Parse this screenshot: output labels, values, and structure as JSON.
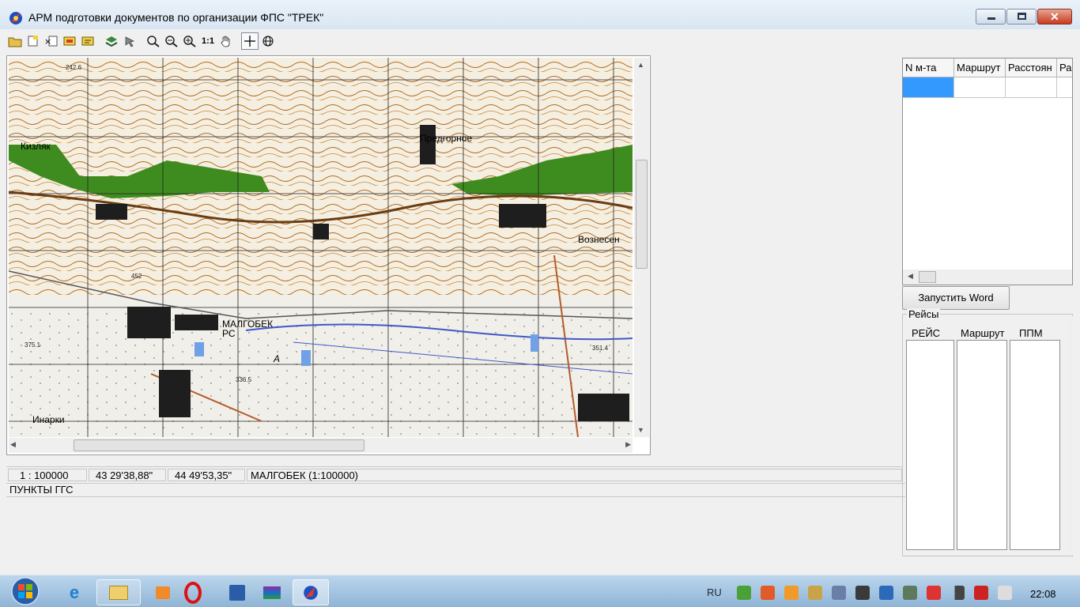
{
  "window": {
    "title": "АРМ подготовки документов по организации ФПС \"ТРЕК\""
  },
  "toolbar": {
    "buttons": [
      "open-icon",
      "new-icon",
      "delete-icon",
      "edit-icon",
      "properties-icon",
      "layers-icon",
      "select-icon",
      "zoom-icon",
      "zoom-out-icon",
      "zoom-in-icon",
      "scale-1-1",
      "pan-hand-icon",
      "crosshair-icon",
      "globe-icon"
    ],
    "scale_1_1_label": "1:1"
  },
  "map": {
    "labels": {
      "town_1": "Кизляк",
      "town_2": "Предгорное",
      "town_3": "Вознесен",
      "town_4": "МАЛГОБЕК",
      "town_5": "Инарки",
      "rc": "РС",
      "elev_1": "242.6",
      "elev_2": "351.4",
      "elev_3": "375.1",
      "elev_4": "336.5",
      "elev_5": "452",
      "sheet": "A"
    }
  },
  "statusbar": {
    "scale": "1 : 100000",
    "lat": "43 29'38,88\"",
    "lon": "44 49'53,35\"",
    "sheet": "МАЛГОБЕК (1:100000)"
  },
  "layer_label": "ПУНКТЫ ГГС",
  "grid": {
    "columns": [
      "N м-та",
      "Маршрут",
      "Расстоян",
      "Ра"
    ]
  },
  "word_button": "Запустить Word",
  "reisy": {
    "legend": "Рейсы",
    "columns": [
      "РЕЙС",
      "Маршрут",
      "ППМ"
    ]
  },
  "taskbar": {
    "lang": "RU",
    "clock": "22:08"
  }
}
